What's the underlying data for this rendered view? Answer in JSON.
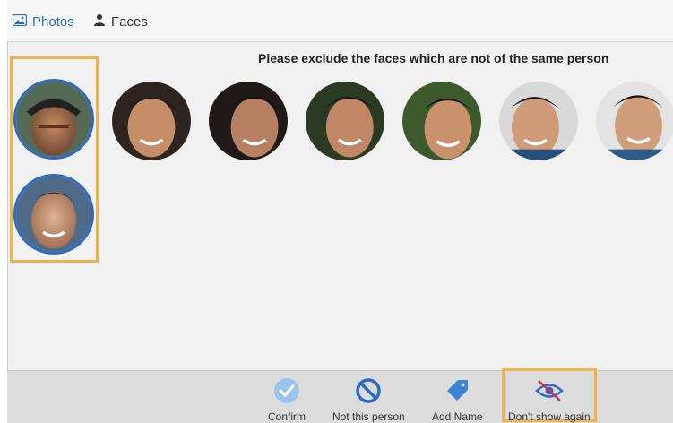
{
  "tabs": [
    {
      "label": "Photos",
      "icon": "photo-icon",
      "color": "#2f6fb3"
    },
    {
      "label": "Faces",
      "icon": "person-icon"
    }
  ],
  "instruction": "Please exclude the faces which are not of the same person",
  "selected_faces": 2,
  "candidate_faces": 7,
  "toolbar": {
    "confirm": "Confirm",
    "not_this_person": "Not this person",
    "add_name": "Add Name",
    "dont_show_again": "Don't show again"
  },
  "colors": {
    "highlight": "#f2b24c",
    "selection_ring": "#2d6ac5",
    "accent": "#2f6fb3"
  }
}
